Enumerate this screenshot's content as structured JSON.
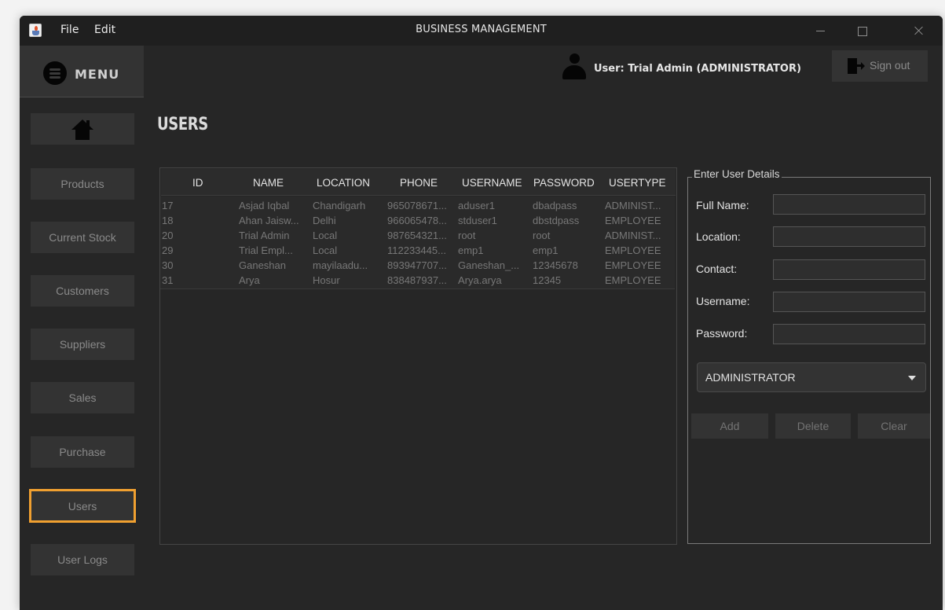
{
  "titlebar": {
    "menu_file": "File",
    "menu_edit": "Edit",
    "title": "BUSINESS MANAGEMENT"
  },
  "sidebar": {
    "menu_label": "MENU",
    "items": [
      {
        "label": "Products"
      },
      {
        "label": "Current Stock"
      },
      {
        "label": "Customers"
      },
      {
        "label": "Suppliers"
      },
      {
        "label": "Sales"
      },
      {
        "label": "Purchase"
      },
      {
        "label": "Users",
        "active": true
      },
      {
        "label": "User Logs"
      }
    ]
  },
  "header": {
    "user_label": "User: Trial Admin (ADMINISTRATOR)",
    "sign_out": "Sign out"
  },
  "page": {
    "title": "USERS"
  },
  "table": {
    "columns": [
      "ID",
      "NAME",
      "LOCATION",
      "PHONE",
      "USERNAME",
      "PASSWORD",
      "USERTYPE"
    ],
    "rows": [
      [
        "17",
        "Asjad Iqbal",
        "Chandigarh",
        "965078671...",
        "aduser1",
        "dbadpass",
        "ADMINIST..."
      ],
      [
        "18",
        "Ahan Jaisw...",
        "Delhi",
        "966065478...",
        "stduser1",
        "dbstdpass",
        "EMPLOYEE"
      ],
      [
        "20",
        "Trial Admin",
        "Local",
        "987654321...",
        "root",
        "root",
        "ADMINIST..."
      ],
      [
        "29",
        "Trial Empl...",
        "Local",
        "112233445...",
        "emp1",
        "emp1",
        "EMPLOYEE"
      ],
      [
        "30",
        "Ganeshan",
        "mayilaadu...",
        "893947707...",
        "Ganeshan_...",
        "12345678",
        "EMPLOYEE"
      ],
      [
        "31",
        "Arya",
        "Hosur",
        "838487937...",
        "Arya.arya",
        "12345",
        "EMPLOYEE"
      ]
    ]
  },
  "form": {
    "legend": "Enter User Details",
    "fields": [
      {
        "label": "Full Name:",
        "value": ""
      },
      {
        "label": "Location:",
        "value": ""
      },
      {
        "label": "Contact:",
        "value": ""
      },
      {
        "label": "Username:",
        "value": ""
      },
      {
        "label": "Password:",
        "value": ""
      }
    ],
    "usertype_selected": "ADMINISTRATOR",
    "buttons": {
      "add": "Add",
      "delete": "Delete",
      "clear": "Clear"
    }
  },
  "colors": {
    "background": "#262626",
    "active_outline": "#f0a030",
    "button": "#333333"
  }
}
